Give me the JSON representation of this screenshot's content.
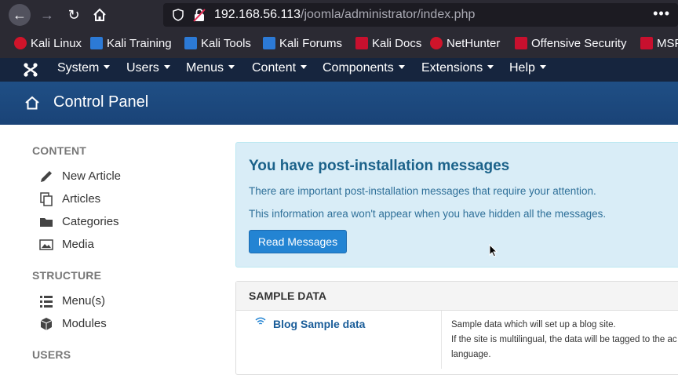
{
  "browser": {
    "url_host": "192.168.56.113",
    "url_path": "/joomla/administrator/index.php",
    "more_label": "•••",
    "bookmarks": [
      {
        "label": "Kali Linux",
        "color": "#d0142a"
      },
      {
        "label": "Kali Training",
        "color": "#2c7ad6"
      },
      {
        "label": "Kali Tools",
        "color": "#2c7ad6"
      },
      {
        "label": "Kali Forums",
        "color": "#2c7ad6"
      },
      {
        "label": "Kali Docs",
        "color": "#c8102e"
      },
      {
        "label": "NetHunter",
        "color": "#d0142a"
      },
      {
        "label": "Offensive Security",
        "color": "#c8102e"
      },
      {
        "label": "MSF",
        "color": "#c8102e"
      }
    ]
  },
  "joomla_nav": {
    "menus": [
      "System",
      "Users",
      "Menus",
      "Content",
      "Components",
      "Extensions",
      "Help"
    ]
  },
  "header": {
    "title": "Control Panel"
  },
  "sidebar": {
    "sections": [
      {
        "heading": "CONTENT",
        "items": [
          "New Article",
          "Articles",
          "Categories",
          "Media"
        ]
      },
      {
        "heading": "STRUCTURE",
        "items": [
          "Menu(s)",
          "Modules"
        ]
      },
      {
        "heading": "USERS",
        "items": []
      }
    ]
  },
  "post_install": {
    "title": "You have post-installation messages",
    "line1": "There are important post-installation messages that require your attention.",
    "line2": "This information area won't appear when you have hidden all the messages.",
    "button": "Read Messages"
  },
  "sample_data": {
    "heading": "SAMPLE DATA",
    "row_title": "Blog Sample data",
    "desc1": "Sample data which will set up a blog site.",
    "desc2": "If the site is multilingual, the data will be tagged to the ac",
    "desc3": "language."
  },
  "colors": {
    "nav_bg": "#16253e",
    "header_bg": "#1f4f85",
    "info_bg": "#d9edf7",
    "button_bg": "#2384d3"
  }
}
